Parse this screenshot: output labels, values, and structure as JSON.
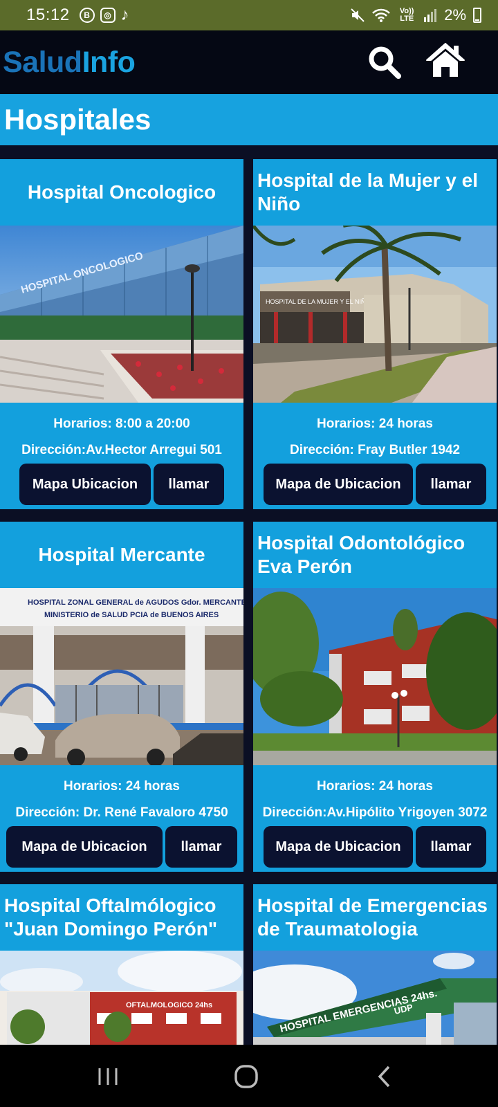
{
  "status_bar": {
    "time": "15:12",
    "icons": [
      "b-chat-icon",
      "instagram-icon",
      "tiktok-icon"
    ],
    "right_icons": [
      "mute-icon",
      "wifi-icon",
      "lte-icon",
      "signal-icon"
    ],
    "lte_label": "Vo)) LTE",
    "battery": "2%"
  },
  "app_bar": {
    "logo_part1": "Salud",
    "logo_part2": "Info",
    "search_icon": "search-icon",
    "home_icon": "home-icon"
  },
  "section": {
    "title": "Hospitales"
  },
  "hospitals": [
    {
      "name": "Hospital Oncologico",
      "hours": "Horarios: 8:00 a 20:00",
      "address": "Dirección:Av.Hector Arregui 501",
      "map_label": "Mapa Ubicacion",
      "call_label": "llamar"
    },
    {
      "name": "Hospital de la Mujer y el Niño",
      "hours": "Horarios: 24 horas",
      "address": "Dirección: Fray Butler 1942",
      "map_label": "Mapa de Ubicacion",
      "call_label": "llamar"
    },
    {
      "name": "Hospital Mercante",
      "hours": "Horarios: 24 horas",
      "address": "Dirección: Dr. René Favaloro 4750",
      "map_label": "Mapa de Ubicacion",
      "call_label": "llamar"
    },
    {
      "name": "Hospital Odontológico Eva Perón",
      "hours": "Horarios: 24 horas",
      "address": "Dirección:Av.Hipólito Yrigoyen 3072",
      "map_label": "Mapa de Ubicacion",
      "call_label": "llamar"
    },
    {
      "name": "Hospital Oftalmólogico \"Juan Domingo Perón\""
    },
    {
      "name": "Hospital de Emergencias de Traumatologia"
    }
  ],
  "photo_signs": {
    "oncologico": "HOSPITAL ONCOLOGICO",
    "mujer": "HOSPITAL DE LA MUJER Y EL NIÑO",
    "mercante_1": "HOSPITAL ZONAL GENERAL de AGUDOS Gdor. MERCANTE",
    "mercante_2": "MINISTERIO de SALUD PCIA de BUENOS AIRES",
    "oftalmo": "OFTALMOLOGICO 24hs",
    "emergencias": "HOSPITAL EMERGENCIAS 24hs.",
    "udp": "UDP"
  },
  "nav_bar": {
    "icons": [
      "recent-apps-icon",
      "home-circle-icon",
      "back-icon"
    ]
  },
  "colors": {
    "accent": "#17a2df",
    "dark": "#050814",
    "button": "#0b1230",
    "status": "#5b6b2a"
  }
}
